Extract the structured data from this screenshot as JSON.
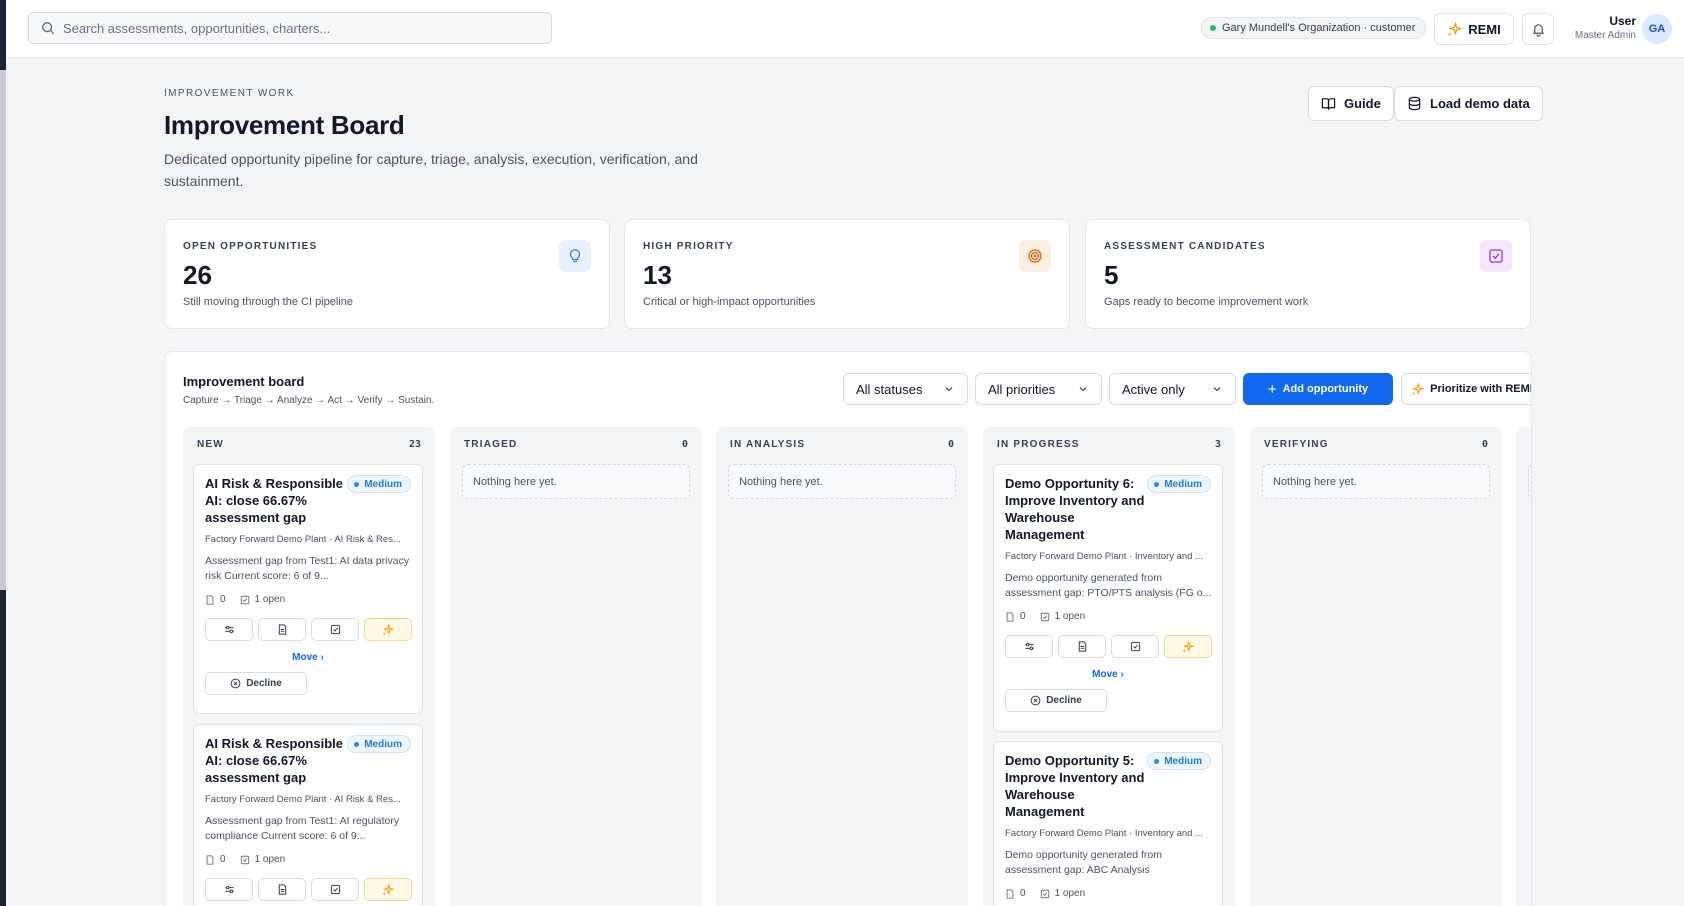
{
  "search": {
    "placeholder": "Search assessments, opportunities, charters..."
  },
  "header": {
    "org_label": "Gary Mundell's Organization · customer",
    "remi_label": "REMI",
    "user_name": "User",
    "user_role": "Master Admin",
    "avatar_initials": "GA"
  },
  "page": {
    "eyebrow": "IMPROVEMENT WORK",
    "title": "Improvement Board",
    "description": "Dedicated opportunity pipeline for capture, triage, analysis, execution, verification, and sustainment.",
    "guide_label": "Guide",
    "load_demo_label": "Load demo data"
  },
  "stats": [
    {
      "label": "OPEN OPPORTUNITIES",
      "value": "26",
      "sub": "Still moving through the CI pipeline",
      "icon": "lightbulb-icon",
      "color": "#3b82f6"
    },
    {
      "label": "HIGH PRIORITY",
      "value": "13",
      "sub": "Critical or high-impact opportunities",
      "icon": "target-icon",
      "color": "#ea580c"
    },
    {
      "label": "ASSESSMENT CANDIDATES",
      "value": "5",
      "sub": "Gaps ready to become improvement work",
      "icon": "check-square-icon",
      "color": "#9333ea"
    }
  ],
  "board": {
    "title": "Improvement board",
    "subtitle": "Capture → Triage → Analyze → Act → Verify → Sustain.",
    "filters": {
      "status": "All statuses",
      "priority": "All priorities",
      "activity": "Active only"
    },
    "add_label": "Add opportunity",
    "prioritize_label": "Prioritize with REMI",
    "empty_text": "Nothing here yet.",
    "columns": [
      {
        "name": "NEW",
        "count": "23"
      },
      {
        "name": "TRIAGED",
        "count": "0"
      },
      {
        "name": "IN ANALYSIS",
        "count": "0"
      },
      {
        "name": "IN PROGRESS",
        "count": "3"
      },
      {
        "name": "VERIFYING",
        "count": "0"
      }
    ],
    "cards": {
      "new_1": {
        "title": "AI Risk & Responsible AI: close 66.67% assessment gap",
        "priority": "Medium",
        "meta": "Factory Forward Demo Plant · AI Risk & Res...",
        "description": "Assessment gap from Test1: AI data privacy risk Current score: 6 of 9...",
        "docs": "0",
        "tasks": "1 open",
        "move_label": "Move",
        "decline_label": "Decline"
      },
      "new_2": {
        "title": "AI Risk & Responsible AI: close 66.67% assessment gap",
        "priority": "Medium",
        "meta": "Factory Forward Demo Plant · AI Risk & Res...",
        "description": "Assessment gap from Test1: AI regulatory compliance Current score: 6 of 9...",
        "docs": "0",
        "tasks": "1 open"
      },
      "prog_1": {
        "title": "Demo Opportunity 6: Improve Inventory and Warehouse Management",
        "priority": "Medium",
        "meta": "Factory Forward Demo Plant · Inventory and ...",
        "description": "Demo opportunity generated from assessment gap: PTO/PTS analysis (FG o...",
        "docs": "0",
        "tasks": "1 open",
        "move_label": "Move",
        "decline_label": "Decline"
      },
      "prog_2": {
        "title": "Demo Opportunity 5: Improve Inventory and Warehouse Management",
        "priority": "Medium",
        "meta": "Factory Forward Demo Plant · Inventory and ...",
        "description": "Demo opportunity generated from assessment gap: ABC Analysis",
        "docs": "0",
        "tasks": "1 open"
      }
    }
  }
}
